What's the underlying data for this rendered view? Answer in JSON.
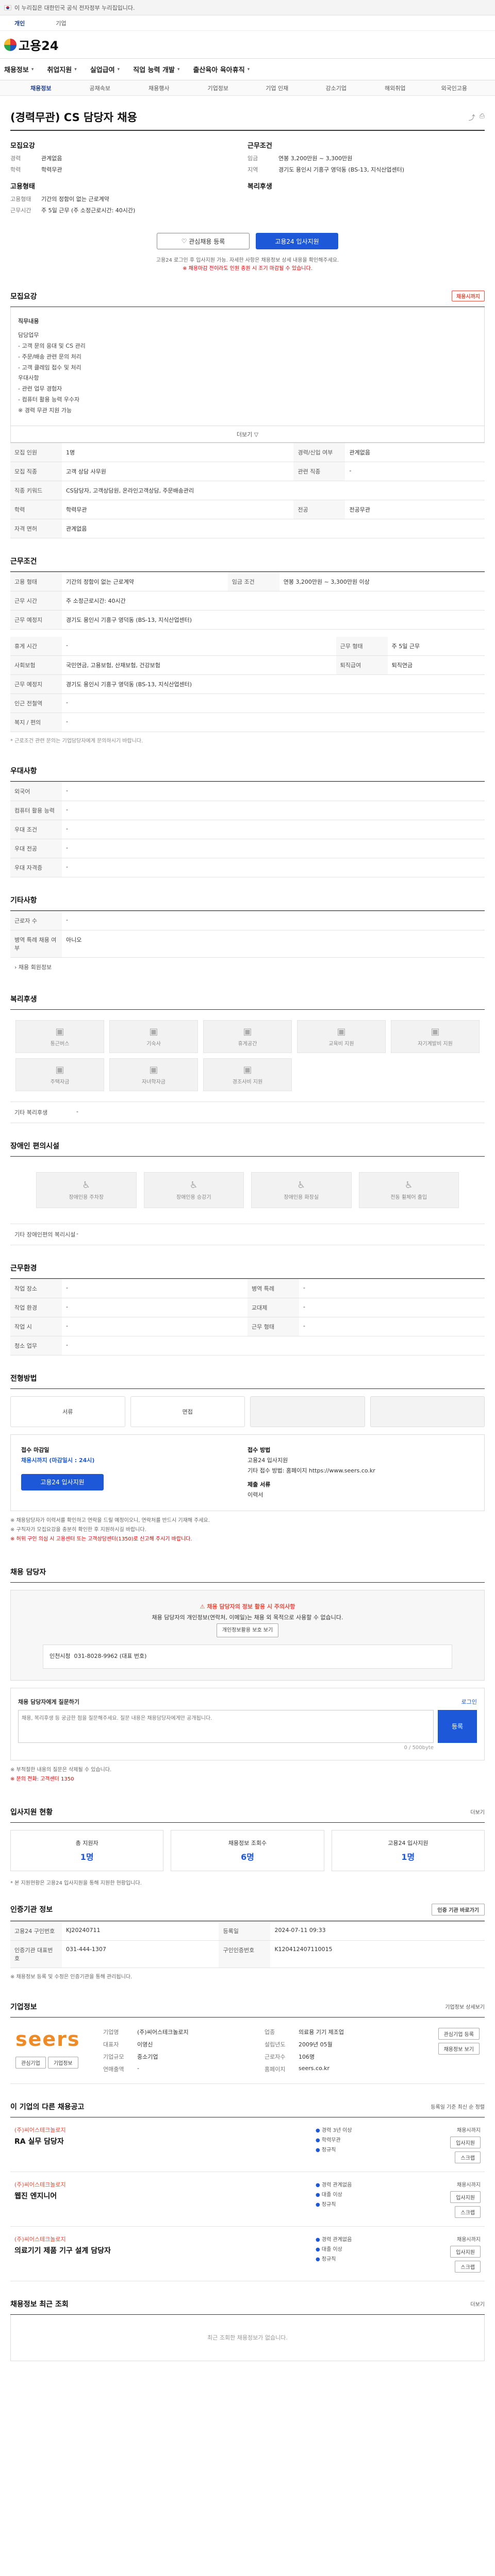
{
  "gov_bar": {
    "text": "이 누리집은 대한민국 공식 전자정부 누리집입니다."
  },
  "topbar": {
    "personal": "개인",
    "corp": "기업"
  },
  "header": {
    "logo_text": "고용24"
  },
  "gnb": {
    "items": [
      "채용정보",
      "취업지원",
      "실업급여",
      "직업 능력 개발",
      "출산육아 육아휴직"
    ]
  },
  "snb": {
    "items": [
      "채용정보",
      "공채속보",
      "채용행사",
      "기업정보",
      "기업 인재",
      "강소기업",
      "해외취업",
      "외국인고용"
    ]
  },
  "job": {
    "title": "(경력무관) CS 담당자 채용",
    "company_label": "모집요강",
    "labels": {
      "career": "경력",
      "education": "학력",
      "work_type": "고용형태",
      "salary": "임금",
      "region": "지역",
      "worktime": "근무시간",
      "welfare": "복지혜택"
    },
    "career": "관계없음",
    "education": "학력무관",
    "work_type_title": "고용형태",
    "work_type_value": "기간의 정함이 없는 근로계약",
    "work_time_value": "주 5일 근무 (주 소정근로시간: 40시간)",
    "salary": "연봉 3,200만원 ~ 3,300만원",
    "region": "경기도 용인시 기흥구 영덕동 (BS-13, 지식산업센터)",
    "welfare_title": "복리후생",
    "like_label": "관심채용 등록",
    "apply_label": "고용24 입사지원"
  },
  "notice": {
    "line1": "고용24 로그인 후 입사지원 가능. 자세한 사항은 채용정보 상세 내용을 확인해주세요.",
    "line2": "※ 채용마감 전이라도 인원 충원 시 조기 마감될 수 있습니다."
  },
  "section_job": {
    "title": "모집요강",
    "closing_label": "채용시까지",
    "desc_title": "직무내용",
    "desc_lines": [
      "담당업무",
      "- 고객 문의 응대 및 CS 관리",
      "- 주문/배송 관련 문의 처리",
      "- 고객 클레임 접수 및 처리",
      "우대사항",
      "- 관련 업무 경험자",
      "- 컴퓨터 활용 능력 우수자",
      "※ 경력 무관 지원 가능"
    ],
    "fold_label": "더보기 ▽",
    "rows": [
      [
        "모집 인원",
        "1명",
        "경력/신입 여부",
        "관계없음"
      ],
      [
        "모집 직종",
        "고객 상담 사무원",
        "관련 직종",
        "-"
      ],
      [
        "직종 키워드",
        "CS담당자, 고객상담원, 온라인고객상담, 주문배송관리",
        "",
        ""
      ],
      [
        "학력",
        "학력무관",
        "전공",
        "전공무관"
      ],
      [
        "자격 면허",
        "관계없음",
        "",
        ""
      ]
    ]
  },
  "section_work": {
    "title": "근무조건",
    "rows": [
      [
        "고용 형태",
        "기간의 정함이 없는 근로계약",
        "임금 조건",
        "연봉 3,200만원 ~ 3,300만원 이상"
      ],
      [
        "근무 시간",
        "주 소정근로시간: 40시간",
        "",
        ""
      ],
      [
        "근무 예정지",
        "경기도 용인시 기흥구 영덕동 (BS-13, 지식산업센터)",
        "",
        ""
      ]
    ],
    "extra_rows": [
      [
        "휴게 시간",
        "-",
        "근무 형태",
        "주 5일 근무"
      ],
      [
        "사회보험",
        "국민연금, 고용보험, 산재보험, 건강보험",
        "퇴직급여",
        "퇴직연금"
      ],
      [
        "근무 예정지",
        "경기도 용인시 기흥구 영덕동 (BS-13, 지식산업센터)",
        "",
        ""
      ],
      [
        "인근 전철역",
        "-",
        "",
        ""
      ],
      [
        "복지 / 편의",
        "-",
        "",
        ""
      ]
    ],
    "map_button": "지도 보기",
    "footnote": "* 근로조건 관련 문의는 기업담당자에게 문의하시기 바랍니다."
  },
  "section_prefer": {
    "title": "우대사항",
    "rows": [
      [
        "외국어",
        "-"
      ],
      [
        "컴퓨터 활용 능력",
        "-"
      ],
      [
        "우대 조건",
        "-"
      ],
      [
        "우대 전공",
        "-"
      ],
      [
        "우대 자격증",
        "-"
      ]
    ]
  },
  "section_etc": {
    "title": "기타사항",
    "rows": [
      [
        "근로자 수",
        "-"
      ],
      [
        "병역 특례 채용 여부",
        "아니오"
      ]
    ],
    "link_label": "채용 회원정보"
  },
  "section_benefit": {
    "title": "복리후생",
    "icons": [
      "통근버스",
      "기숙사",
      "휴게공간",
      "교육비 지원",
      "자기계발비 지원",
      "주택자금",
      "자녀학자금",
      "경조사비 지원"
    ],
    "etc_label": "기타 복리후생",
    "etc_value": "-"
  },
  "section_disabled": {
    "title": "장애인 편의시설",
    "icons": [
      "장애인용 주차장",
      "장애인용 승강기",
      "장애인용 화장실",
      "전동 휠체어 출입"
    ],
    "etc_label": "기타 장애인편의 복리시설",
    "etc_value": "-"
  },
  "section_place": {
    "title": "근무환경",
    "rows": [
      [
        "작업 장소",
        "-",
        "",
        ""
      ],
      [
        "작업 환경",
        "-",
        "",
        ""
      ],
      [
        "작업 시",
        "-",
        "",
        ""
      ],
      [
        "청소 업무",
        "-",
        "",
        ""
      ]
    ],
    "right_rows": [
      [
        "병역 특례",
        "-"
      ],
      [
        "교대제",
        "-"
      ],
      [
        "근무 형태",
        "-"
      ]
    ]
  },
  "section_process": {
    "title": "전형방법",
    "steps": [
      "서류",
      "면접",
      "",
      ""
    ],
    "dim": [
      false,
      false,
      true,
      true
    ],
    "apply_title": "접수 마감일",
    "apply_date": "채용시까지 (마감일시 : 24시)",
    "apply_method_title": "접수 방법",
    "apply_method": "고용24 입사지원",
    "apply_etc": "기타 접수 방법: 홈페이지 https://www.seers.co.kr",
    "docs_title": "제출 서류",
    "docs": "이력서",
    "apply_button": "고용24 입사지원"
  },
  "process_notes": [
    "※ 채용담당자가 이력서를 확인하고 연락을 드릴 예정이오니, 연락처를 반드시 기재해 주세요.",
    "※ 구직자가 모집요강을 충분히 확인한 후 지원하시길 바랍니다.",
    "※ 허위 구인 의심 시 고용센터 또는 고객상담센터(1350)로 신고해 주시기 바랍니다."
  ],
  "section_contact": {
    "title": "채용 담당자",
    "warn": "채용 담당자의 정보 활용 시 주의사항",
    "desc": "채용 담당자의 개인정보(연락처, 이메일)는 채용 외 목적으로 사용할 수 없습니다.",
    "contact_button": "개인정보활용 보호 보기",
    "inner_label": "인천시청",
    "inner_value": "031-8028-9962 (대표 번호)"
  },
  "inquiry": {
    "title": "채용 담당자에게 질문하기",
    "login": "로그인",
    "placeholder": "채용, 복리후생 등 궁금한 점을 질문해주세요. 질문 내용은 채용담당자에게만 공개됩니다.",
    "count": "0 / 500byte",
    "submit": "등록"
  },
  "inquiry_notes": [
    "※ 부적절한 내용의 질문은 삭제될 수 있습니다.",
    "※ 문의 전화: 고객센터 1350"
  ],
  "section_stats": {
    "title": "입사지원 현황",
    "more": "더보기",
    "stats": [
      {
        "label": "총 지원자",
        "num": "1명"
      },
      {
        "label": "채용정보 조회수",
        "num": "6명"
      },
      {
        "label": "고용24 입사지원",
        "num": "1명"
      }
    ],
    "note": "* 본 지원현황은 고용24 입사지원을 통해 지원한 현황입니다."
  },
  "section_info": {
    "title": "인증기관 정보",
    "more": "인증 기관 바로가기",
    "rows": [
      [
        "고용24 구인번호",
        "KJ20240711",
        "등록일",
        "2024-07-11 09:33"
      ],
      [
        "인증기관 대표번호",
        "031-444-1307",
        "구인인증번호",
        "K120412407110015"
      ]
    ],
    "note": "※ 채용정보 등록 및 수정은 인증기관을 통해 관리됩니다."
  },
  "section_company": {
    "title": "기업정보",
    "more": "기업정보 상세보기",
    "logo": "seers",
    "buttons": [
      "관심기업",
      "기업정보"
    ],
    "fields": [
      [
        "기업명",
        "(주)씨어스테크놀로지",
        "업종",
        "의료용 기기 제조업"
      ],
      [
        "대표자",
        "이영신",
        "설립년도",
        "2009년 05월"
      ],
      [
        "기업규모",
        "중소기업",
        "근로자수",
        "106명"
      ],
      [
        "연매출액",
        "-",
        "홈페이지",
        "seers.co.kr"
      ]
    ],
    "actions": [
      "관심기업 등록",
      "채용정보 보기"
    ]
  },
  "section_related": {
    "title": "이 기업의 다른 채용공고",
    "more": "등록일 기준 최신 순 정렬",
    "items": [
      {
        "company": "(주)씨어스테크놀로지",
        "title": "RA 실무 담당자",
        "l1": "경력 3년 이상",
        "l2": "학력무관",
        "l3": "정규직",
        "deadline": "채용시까지"
      },
      {
        "company": "(주)씨어스테크놀로지",
        "title": "웹진 엔지니어",
        "l1": "경력 관계없음",
        "l2": "대졸 이상",
        "l3": "정규직",
        "deadline": "채용시까지"
      },
      {
        "company": "(주)씨어스테크놀로지",
        "title": "의료기기 제품 기구 설계 담당자",
        "l1": "경력 관계없음",
        "l2": "대졸 이상",
        "l3": "정규직",
        "deadline": "채용시까지"
      }
    ],
    "apply_label": "입사지원",
    "scrap_label": "스크랩"
  },
  "section_recent": {
    "title": "채용정보 최근 조회",
    "more": "더보기",
    "empty": "최근 조회한 채용정보가 없습니다."
  }
}
